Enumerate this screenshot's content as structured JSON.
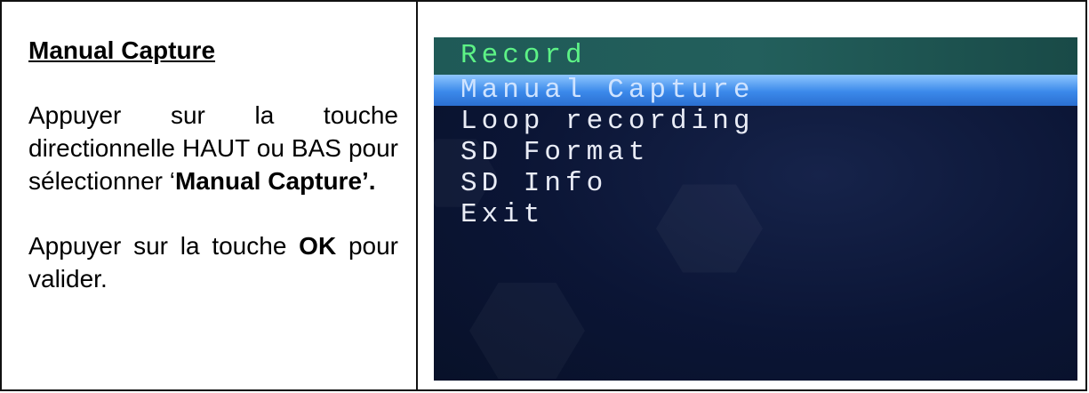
{
  "doc": {
    "heading": "Manual Capture",
    "para1_pre": "Appuyer sur la touche directionnelle HAUT ou BAS pour sélectionner ‘",
    "para1_bold": "Manual Capture’.",
    "para2_pre": "Appuyer sur la touche ",
    "para2_bold": "OK",
    "para2_post": " pour valider."
  },
  "menu": {
    "title": "Record",
    "items": [
      {
        "label": "Manual Capture",
        "selected": true
      },
      {
        "label": "Loop recording",
        "selected": false
      },
      {
        "label": "SD Format",
        "selected": false
      },
      {
        "label": "SD Info",
        "selected": false
      },
      {
        "label": "Exit",
        "selected": false
      }
    ]
  }
}
